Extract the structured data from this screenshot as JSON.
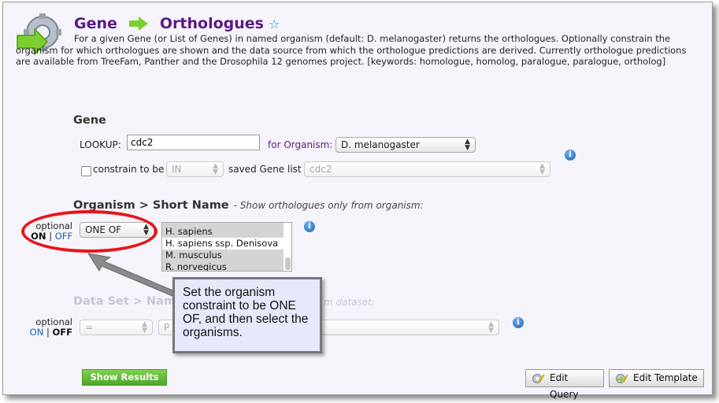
{
  "header": {
    "from": "Gene",
    "to": "Orthologues",
    "description": "For a given Gene (or List of Genes) in named organism (default: D. melanogaster) returns the orthologues. Optionally constrain the organism for which orthologues are shown and the data source from which the orthologue predictions are derived. Currently orthologue predictions are available from TreeFam, Panther and the Drosophila 12 genomes project. [keywords: homologue, homolog, paralogue, paralogue, ortholog]"
  },
  "gene": {
    "title": "Gene",
    "lookup_label": "LOOKUP:",
    "lookup_value": "cdc2",
    "for_organism_label": "for Organism:",
    "organism_value": "D. melanogaster",
    "constrain_label": "constrain to be",
    "constrain_op": "IN",
    "saved_list_label": "saved Gene list",
    "saved_list_value": "cdc2"
  },
  "organism": {
    "title": "Organism > Short Name",
    "subtitle": "- Show orthologues only from organism:",
    "optional": "optional",
    "on": "ON",
    "sep": "|",
    "off": "OFF",
    "operator": "ONE OF",
    "options": [
      "H. sapiens",
      "H. sapiens ssp. Denisova",
      "M. musculus",
      "R. norvegicus"
    ]
  },
  "dataset": {
    "title_visible": "Data Set > Nam",
    "subtitle_visible": "m dataset:",
    "optional": "optional",
    "on": "ON",
    "sep": "|",
    "off": "OFF",
    "operator": "=",
    "value": "P"
  },
  "callout": {
    "text": "Set the organism constraint to be ONE OF, and then select the organisms."
  },
  "buttons": {
    "show_results": "Show Results",
    "edit_query": "Edit Query",
    "edit_template": "Edit Template"
  },
  "colors": {
    "title_purple": "#5a1a84",
    "arrow_green": "#7ccf2e",
    "highlight_red": "#e8141a",
    "link_blue": "#1a5fb4"
  }
}
